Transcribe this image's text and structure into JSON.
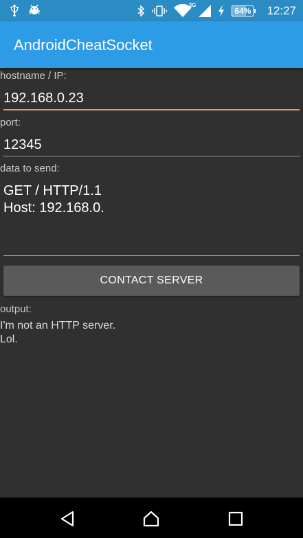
{
  "status_bar": {
    "time": "12:27",
    "battery_percent": 64,
    "battery_label": "64%",
    "network_type": "3G",
    "icons": [
      "usb-icon",
      "android-debug-icon",
      "bluetooth-icon",
      "vibrate-icon",
      "wifi-icon",
      "cell-signal-icon",
      "charging-icon",
      "battery-icon"
    ]
  },
  "app_bar": {
    "title": "AndroidCheatSocket"
  },
  "form": {
    "hostname_label": "hostname / IP:",
    "hostname_value": "192.168.0.23",
    "port_label": "port:",
    "port_value": "12345",
    "data_label": "data to send:",
    "data_value": "GET / HTTP/1.1\nHost: 192.168.0.",
    "contact_button_label": "CONTACT SERVER"
  },
  "output": {
    "label": "output:",
    "text": "I'm not an HTTP server.\nLol."
  },
  "nav_bar": {
    "icons": [
      "back-icon",
      "home-icon",
      "recents-icon"
    ]
  },
  "colors": {
    "status_bar": "#2b8bc5",
    "app_bar": "#2e9be6",
    "background": "#303030",
    "focused_underline": "#c9a07d",
    "button": "#5a5a5a"
  }
}
